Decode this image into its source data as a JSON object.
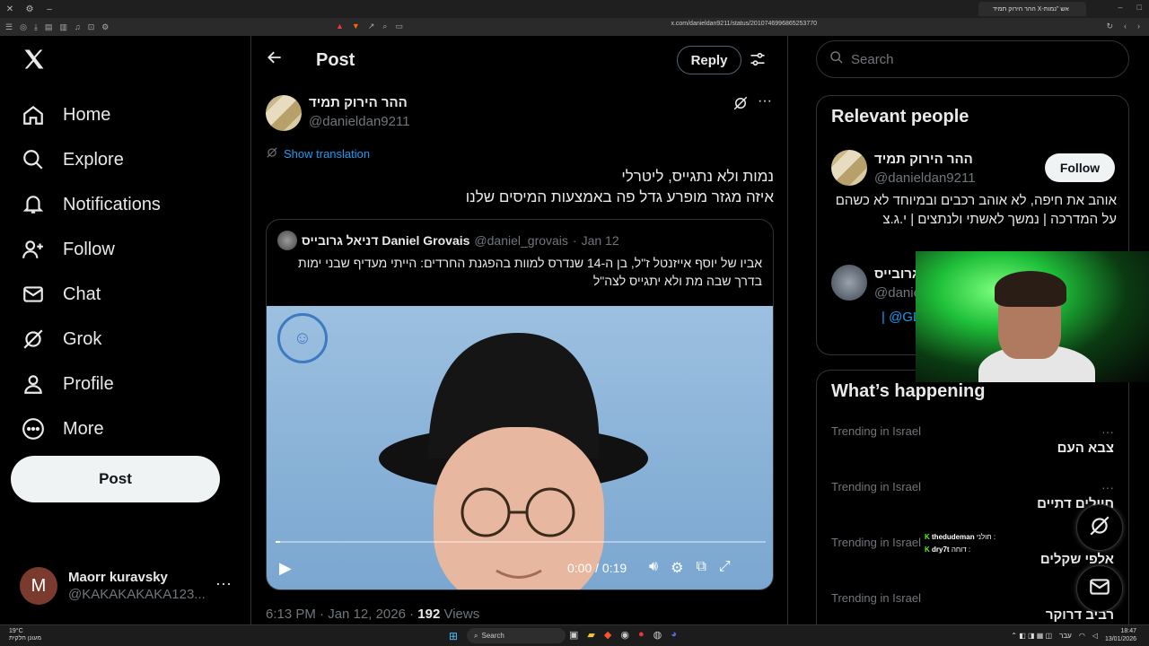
{
  "browser": {
    "tab_title": "ההר הירוק תמיד X-אש \"נמות",
    "url": "x.com/danieldan9211/status/2010746996865253770"
  },
  "nav": {
    "items": [
      {
        "label": "Home",
        "icon": "home-icon"
      },
      {
        "label": "Explore",
        "icon": "search-icon"
      },
      {
        "label": "Notifications",
        "icon": "bell-icon"
      },
      {
        "label": "Follow",
        "icon": "person-add-icon"
      },
      {
        "label": "Chat",
        "icon": "mail-icon"
      },
      {
        "label": "Grok",
        "icon": "grok-icon"
      },
      {
        "label": "Profile",
        "icon": "person-icon"
      },
      {
        "label": "More",
        "icon": "more-circle-icon"
      }
    ],
    "post_label": "Post",
    "account": {
      "initial": "M",
      "name": "Maorr kuravsky",
      "handle": "@KAKAKAKAKA123..."
    }
  },
  "main": {
    "title": "Post",
    "reply_label": "Reply",
    "author": {
      "name": "ההר הירוק תמיד",
      "handle": "@danieldan9211"
    },
    "show_translation": "Show translation",
    "text_line1": "נמות ולא נתגייס, ליטרלי",
    "text_line2": "איזה מגזר מופרע גדל פה באמצעות המיסים שלנו",
    "quote": {
      "name": "דניאל גרובייס Daniel Grovais",
      "handle": "@daniel_grovais",
      "date": "Jan 12",
      "text": "אביו של יוסף אייזנטל ז\"ל, בן ה-14 שנדרס למוות בהפגנת החרדים: הייתי מעדיף שבני ימות בדרך שבה מת ולא יתגייס לצה\"ל",
      "video_time": "0:00 / 0:19",
      "progress": 0.01
    },
    "footer_time": "6:13 PM · Jan 12, 2026 · ",
    "views_count": "192",
    "views_label": " Views"
  },
  "right": {
    "search_placeholder": "Search",
    "relevant_title": "Relevant people",
    "person1": {
      "name": "ההר הירוק תמיד",
      "handle": "@danieldan9211",
      "follow_label": "Follow",
      "bio": "אוהב את חיפה, לא אוהב רכבים ובמיוחד לא כשהם על המדרכה | נמשך לאשתי ולנתצים | י.ג.צ"
    },
    "person2": {
      "name": "גרובייס",
      "handle": "@danie",
      "extra": "| @GL"
    },
    "happening_title": "What’s happening",
    "trends": [
      {
        "label": "Trending in Israel",
        "name": "צבא העם"
      },
      {
        "label": "Trending in Israel",
        "name": "חיילים דתיים"
      },
      {
        "label": "Trending in Israel",
        "name": "אלפי שקלים"
      },
      {
        "label": "Trending in Israel",
        "name": "רביב דרוקר"
      }
    ]
  },
  "overlay_chat": [
    {
      "user": "thedudeman",
      "msg": "חולני :"
    },
    {
      "user": "dry7t",
      "msg": "דוחה :"
    }
  ],
  "taskbar": {
    "weather": "19°C",
    "weather_sub": "מעונן חלקית",
    "search_label": "Search",
    "lang": "עבר",
    "time": "18:47",
    "date": "13/01/2026"
  }
}
